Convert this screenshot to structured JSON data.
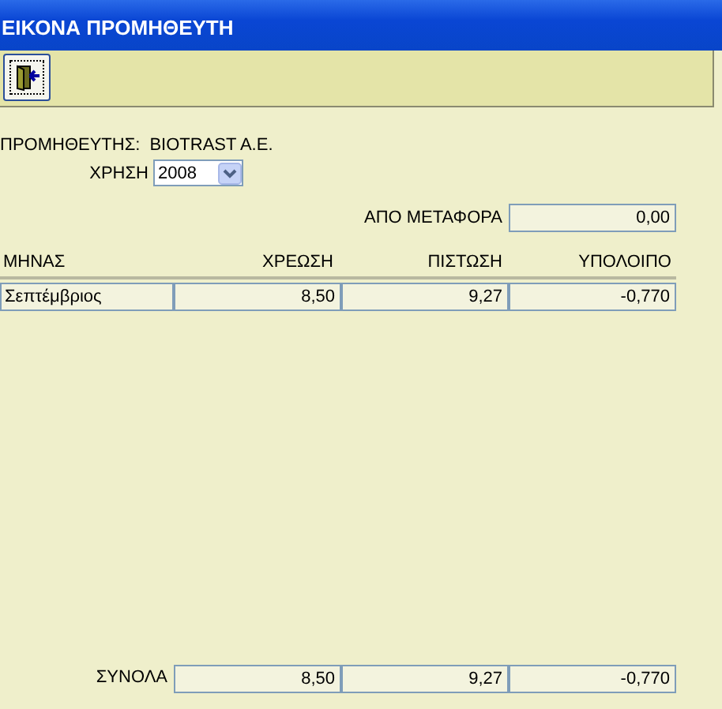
{
  "window": {
    "title": "ΕΙΚΟΝΑ ΠΡΟΜΗΘΕΥΤΗ"
  },
  "supplier": {
    "label": "ΠΡΟΜΗΘΕΥΤΗΣ:",
    "value": "BIOTRAST A.E."
  },
  "year": {
    "label": "ΧΡΗΣΗ",
    "value": "2008"
  },
  "carry_over": {
    "label": "ΑΠΟ ΜΕΤΑΦΟΡΑ",
    "value": "0,00"
  },
  "table": {
    "columns": [
      "ΜΗΝΑΣ",
      "ΧΡΕΩΣΗ",
      "ΠΙΣΤΩΣΗ",
      "ΥΠΟΛΟΙΠΟ"
    ],
    "rows": [
      [
        "Σεπτέμβριος",
        "8,50",
        "9,27",
        "-0,770"
      ]
    ]
  },
  "totals": {
    "label": "ΣΥΝΟΛΑ",
    "values": [
      "8,50",
      "9,27",
      "-0,770"
    ]
  }
}
